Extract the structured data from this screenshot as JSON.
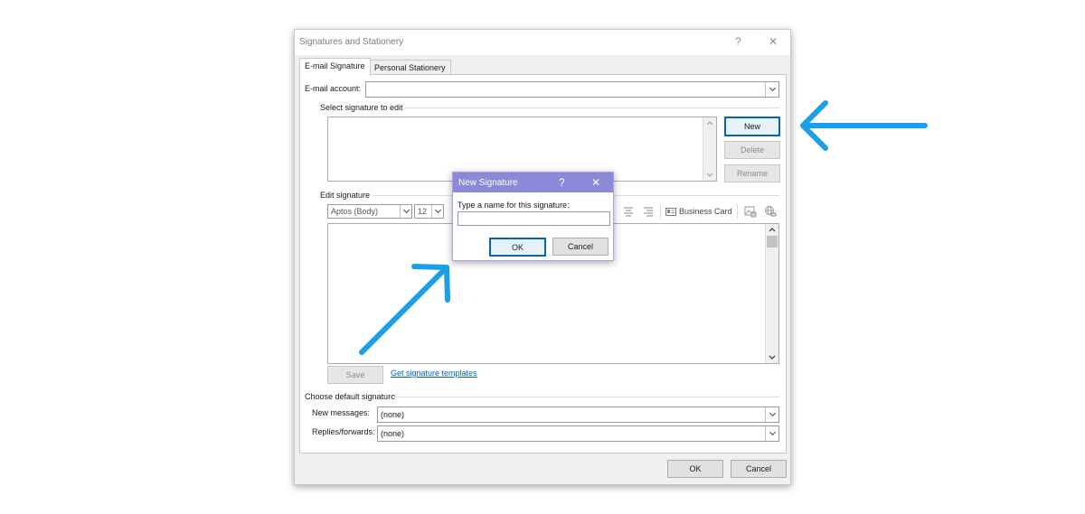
{
  "dialog": {
    "title": "Signatures and Stationery",
    "help_label": "?",
    "close_label": "✕",
    "tabs": [
      {
        "label": "E-mail Signature",
        "active": true
      },
      {
        "label": "Personal Stationery",
        "active": false
      }
    ],
    "email_account": {
      "label": "E-mail account:",
      "value": ""
    },
    "select_signature": {
      "group_label": "Select signature to edit",
      "items": [],
      "new_label": "New",
      "delete_label": "Delete",
      "rename_label": "Rename"
    },
    "edit_signature": {
      "group_label": "Edit signature",
      "font_value": "Aptos (Body)",
      "size_value": "12",
      "business_card_label": "Business Card",
      "body_text": ""
    },
    "save_label": "Save",
    "templates_link": "Get signature templates",
    "default_signature": {
      "group_label": "Choose default signature",
      "new_messages_label": "New messages:",
      "new_messages_value": "(none)",
      "replies_label": "Replies/forwards:",
      "replies_value": "(none)"
    },
    "ok_label": "OK",
    "cancel_label": "Cancel"
  },
  "new_signature_dialog": {
    "title": "New Signature",
    "help_label": "?",
    "close_label": "✕",
    "prompt": "Type a name for this signature:",
    "name_value": "",
    "ok_label": "OK",
    "cancel_label": "Cancel"
  },
  "colors": {
    "accent_arrow": "#1aa0e6",
    "subdialog_titlebar": "#8c89d9",
    "default_button_border": "#0a64ad",
    "link": "#0563c1"
  },
  "icons": [
    "help-icon",
    "close-icon",
    "chevron-down-icon",
    "align-center-icon",
    "align-right-icon",
    "business-card-icon",
    "picture-icon",
    "hyperlink-icon",
    "scroll-up-icon",
    "scroll-down-icon",
    "annotation-arrow-icon"
  ]
}
